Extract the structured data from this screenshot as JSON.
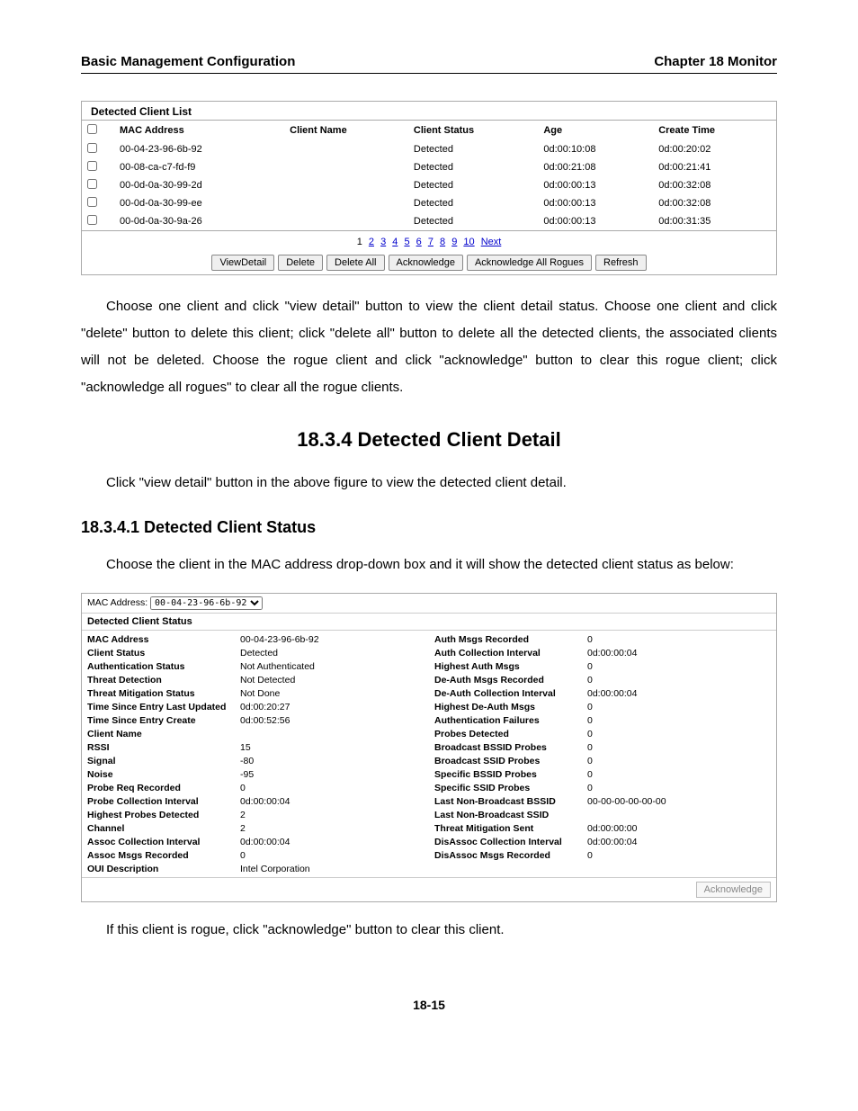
{
  "header": {
    "left": "Basic Management Configuration",
    "right": "Chapter 18 Monitor"
  },
  "client_list": {
    "title": "Detected Client List",
    "columns": [
      "MAC Address",
      "Client Name",
      "Client Status",
      "Age",
      "Create Time"
    ],
    "rows": [
      {
        "mac": "00-04-23-96-6b-92",
        "name": "",
        "status": "Detected",
        "age": "0d:00:10:08",
        "create": "0d:00:20:02"
      },
      {
        "mac": "00-08-ca-c7-fd-f9",
        "name": "",
        "status": "Detected",
        "age": "0d:00:21:08",
        "create": "0d:00:21:41"
      },
      {
        "mac": "00-0d-0a-30-99-2d",
        "name": "",
        "status": "Detected",
        "age": "0d:00:00:13",
        "create": "0d:00:32:08"
      },
      {
        "mac": "00-0d-0a-30-99-ee",
        "name": "",
        "status": "Detected",
        "age": "0d:00:00:13",
        "create": "0d:00:32:08"
      },
      {
        "mac": "00-0d-0a-30-9a-26",
        "name": "",
        "status": "Detected",
        "age": "0d:00:00:13",
        "create": "0d:00:31:35"
      }
    ],
    "pager": {
      "current": "1",
      "pages": [
        "2",
        "3",
        "4",
        "5",
        "6",
        "7",
        "8",
        "9",
        "10"
      ],
      "next": "Next"
    },
    "buttons": {
      "view": "ViewDetail",
      "delete": "Delete",
      "delete_all": "Delete All",
      "acknowledge": "Acknowledge",
      "ack_all": "Acknowledge All Rogues",
      "refresh": "Refresh"
    }
  },
  "para1": "Choose one client and click \"view detail\" button to view the client detail status. Choose one client and click \"delete\" button to delete this client; click \"delete all\" button to delete all the detected clients, the associated clients will not be deleted. Choose the rogue client and click \"acknowledge\" button to clear this rogue client; click \"acknowledge all rogues\" to clear all the rogue clients.",
  "heading_main": "18.3.4 Detected Client Detail",
  "para2": "Click \"view detail\" button in the above figure to view the detected client detail.",
  "heading_sub": "18.3.4.1 Detected Client Status",
  "para3": "Choose the client in the MAC address drop-down box and it will show the detected client status as below:",
  "status_panel": {
    "mac_label": "MAC Address:",
    "mac_selected": "00-04-23-96-6b-92",
    "title": "Detected Client Status",
    "left": [
      {
        "label": "MAC Address",
        "value": "00-04-23-96-6b-92"
      },
      {
        "label": "Client Status",
        "value": "Detected"
      },
      {
        "label": "Authentication Status",
        "value": "Not Authenticated"
      },
      {
        "label": "Threat Detection",
        "value": "Not Detected"
      },
      {
        "label": "Threat Mitigation Status",
        "value": "Not Done"
      },
      {
        "label": "Time Since Entry Last Updated",
        "value": "0d:00:20:27"
      },
      {
        "label": "Time Since Entry Create",
        "value": "0d:00:52:56"
      },
      {
        "label": "Client Name",
        "value": ""
      },
      {
        "label": "RSSI",
        "value": "15"
      },
      {
        "label": "Signal",
        "value": "-80"
      },
      {
        "label": "Noise",
        "value": "-95"
      },
      {
        "label": "Probe Req Recorded",
        "value": "0"
      },
      {
        "label": "Probe Collection Interval",
        "value": "0d:00:00:04"
      },
      {
        "label": "Highest Probes Detected",
        "value": "2"
      },
      {
        "label": "Channel",
        "value": "2"
      },
      {
        "label": "Assoc Collection Interval",
        "value": "0d:00:00:04"
      },
      {
        "label": "Assoc Msgs Recorded",
        "value": "0"
      },
      {
        "label": "OUI Description",
        "value": "Intel Corporation"
      }
    ],
    "right": [
      {
        "label": "Auth Msgs Recorded",
        "value": "0"
      },
      {
        "label": "Auth Collection Interval",
        "value": "0d:00:00:04"
      },
      {
        "label": "Highest Auth Msgs",
        "value": "0"
      },
      {
        "label": "De-Auth Msgs Recorded",
        "value": "0"
      },
      {
        "label": "De-Auth Collection Interval",
        "value": "0d:00:00:04"
      },
      {
        "label": "Highest De-Auth Msgs",
        "value": "0"
      },
      {
        "label": "Authentication Failures",
        "value": "0"
      },
      {
        "label": "Probes Detected",
        "value": "0"
      },
      {
        "label": "Broadcast BSSID Probes",
        "value": "0"
      },
      {
        "label": "Broadcast SSID Probes",
        "value": "0"
      },
      {
        "label": "Specific BSSID Probes",
        "value": "0"
      },
      {
        "label": "Specific SSID Probes",
        "value": "0"
      },
      {
        "label": "Last Non-Broadcast BSSID",
        "value": "00-00-00-00-00-00"
      },
      {
        "label": "Last Non-Broadcast SSID",
        "value": ""
      },
      {
        "label": "Threat Mitigation Sent",
        "value": "0d:00:00:00"
      },
      {
        "label": "DisAssoc Collection Interval",
        "value": "0d:00:00:04"
      },
      {
        "label": "DisAssoc Msgs Recorded",
        "value": "0"
      }
    ],
    "ack_btn": "Acknowledge"
  },
  "para4": "If this client is rogue, click \"acknowledge\" button to clear this client.",
  "footer": "18-15"
}
